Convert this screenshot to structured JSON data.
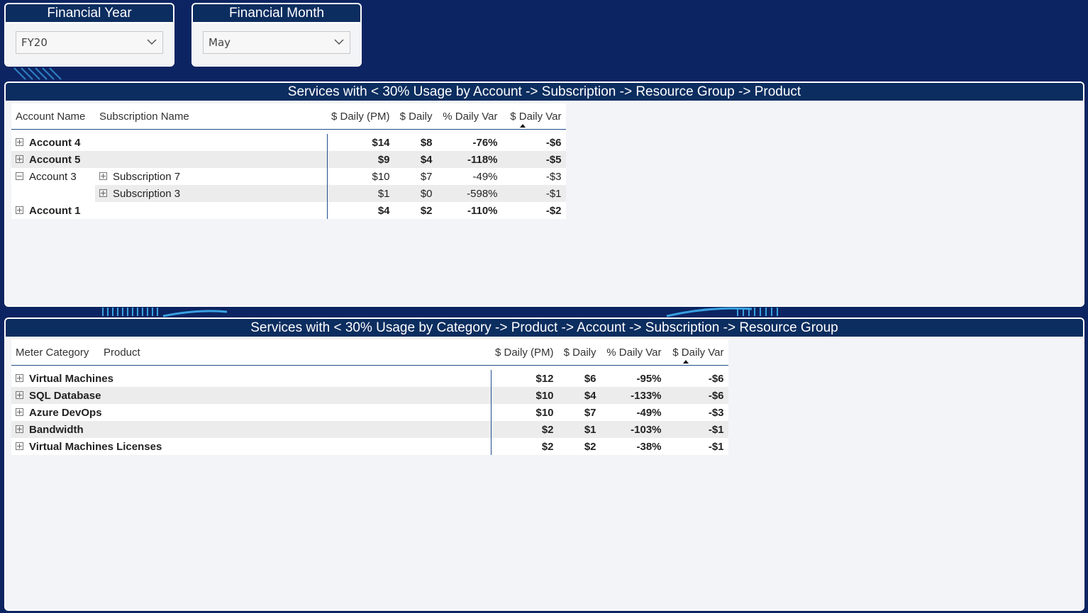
{
  "slicers": {
    "year": {
      "title": "Financial Year",
      "value": "FY20"
    },
    "month": {
      "title": "Financial Month",
      "value": "May"
    }
  },
  "account_table": {
    "title": "Services with < 30% Usage by Account -> Subscription -> Resource Group -> Product",
    "headers": {
      "account": "Account Name",
      "subscription": "Subscription Name",
      "daily_pm": "$ Daily (PM)",
      "daily": "$ Daily",
      "pct_var": "% Daily Var",
      "daily_var": "$ Daily Var"
    },
    "rows": [
      {
        "account": "Account 4",
        "daily_pm": "$14",
        "daily": "$8",
        "pct_var": "-76%",
        "daily_var": "-$6"
      },
      {
        "account": "Account 5",
        "daily_pm": "$9",
        "daily": "$4",
        "pct_var": "-118%",
        "daily_var": "-$5"
      },
      {
        "account": "Account 3",
        "subscription": "Subscription 7",
        "daily_pm": "$10",
        "daily": "$7",
        "pct_var": "-49%",
        "daily_var": "-$3"
      },
      {
        "subscription": "Subscription 3",
        "daily_pm": "$1",
        "daily": "$0",
        "pct_var": "-598%",
        "daily_var": "-$1"
      },
      {
        "account": "Account 1",
        "daily_pm": "$4",
        "daily": "$2",
        "pct_var": "-110%",
        "daily_var": "-$2"
      }
    ]
  },
  "category_table": {
    "title": "Services with < 30% Usage by Category -> Product -> Account -> Subscription -> Resource Group",
    "headers": {
      "category": "Meter Category",
      "product": "Product",
      "daily_pm": "$ Daily (PM)",
      "daily": "$ Daily",
      "pct_var": "% Daily Var",
      "daily_var": "$ Daily Var"
    },
    "rows": [
      {
        "category": "Virtual Machines",
        "daily_pm": "$12",
        "daily": "$6",
        "pct_var": "-95%",
        "daily_var": "-$6"
      },
      {
        "category": "SQL Database",
        "daily_pm": "$10",
        "daily": "$4",
        "pct_var": "-133%",
        "daily_var": "-$6"
      },
      {
        "category": "Azure DevOps",
        "daily_pm": "$10",
        "daily": "$7",
        "pct_var": "-49%",
        "daily_var": "-$3"
      },
      {
        "category": "Bandwidth",
        "daily_pm": "$2",
        "daily": "$1",
        "pct_var": "-103%",
        "daily_var": "-$1"
      },
      {
        "category": "Virtual Machines Licenses",
        "daily_pm": "$2",
        "daily": "$2",
        "pct_var": "-38%",
        "daily_var": "-$1"
      }
    ]
  }
}
